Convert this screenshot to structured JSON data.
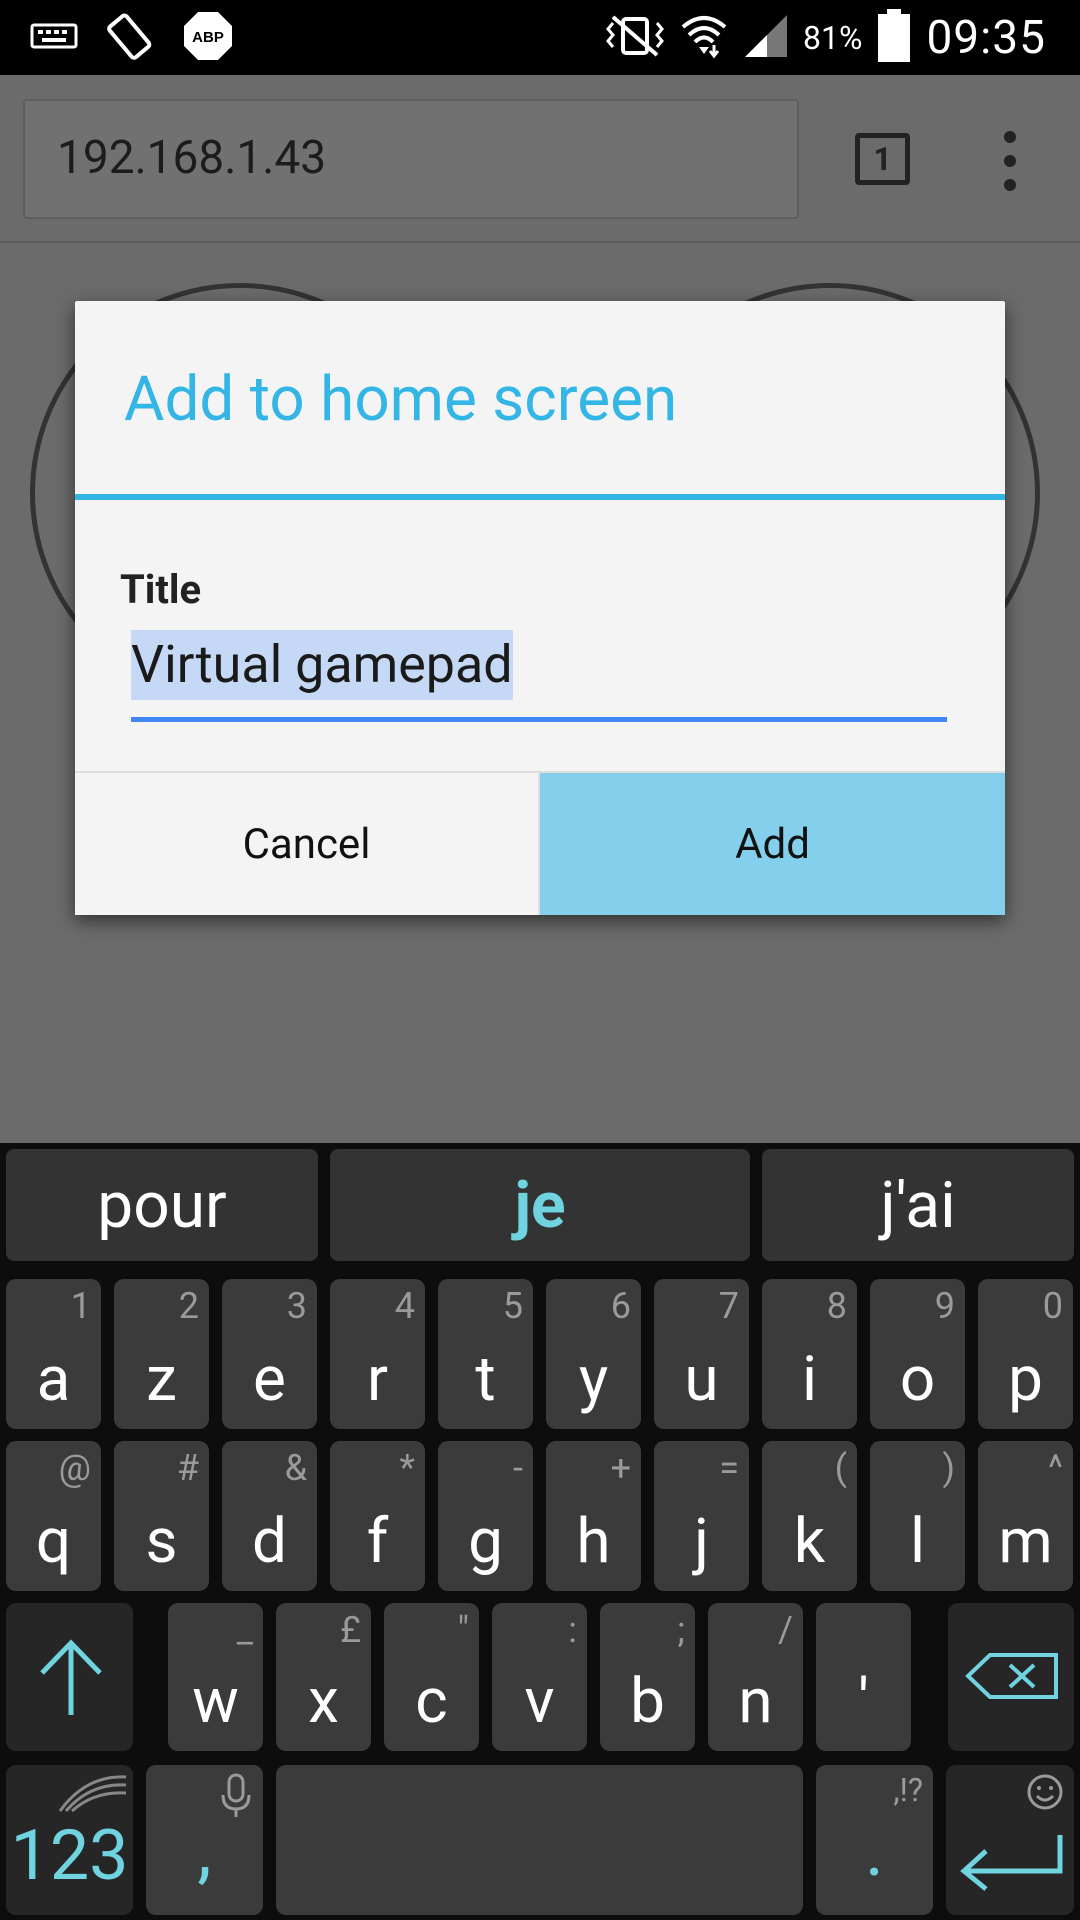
{
  "status_bar": {
    "battery": "81%",
    "time": "09:35"
  },
  "browser": {
    "url": "192.168.1.43",
    "tab_count": "1"
  },
  "dialog": {
    "title": "Add to home screen",
    "field_label": "Title",
    "field_value": "Virtual gamepad",
    "cancel_label": "Cancel",
    "add_label": "Add"
  },
  "keyboard": {
    "suggestions": [
      "pour",
      "je",
      "j'ai"
    ],
    "row1": [
      {
        "key": "a",
        "hint": "1"
      },
      {
        "key": "z",
        "hint": "2"
      },
      {
        "key": "e",
        "hint": "3"
      },
      {
        "key": "r",
        "hint": "4"
      },
      {
        "key": "t",
        "hint": "5"
      },
      {
        "key": "y",
        "hint": "6"
      },
      {
        "key": "u",
        "hint": "7"
      },
      {
        "key": "i",
        "hint": "8"
      },
      {
        "key": "o",
        "hint": "9"
      },
      {
        "key": "p",
        "hint": "0"
      }
    ],
    "row2": [
      {
        "key": "q",
        "hint": "@"
      },
      {
        "key": "s",
        "hint": "#"
      },
      {
        "key": "d",
        "hint": "&"
      },
      {
        "key": "f",
        "hint": "*"
      },
      {
        "key": "g",
        "hint": "-"
      },
      {
        "key": "h",
        "hint": "+"
      },
      {
        "key": "j",
        "hint": "="
      },
      {
        "key": "k",
        "hint": "("
      },
      {
        "key": "l",
        "hint": ")"
      },
      {
        "key": "m",
        "hint": "^"
      }
    ],
    "row3": [
      {
        "key": "w",
        "hint": "_"
      },
      {
        "key": "x",
        "hint": "£"
      },
      {
        "key": "c",
        "hint": "\""
      },
      {
        "key": "v",
        "hint": ":"
      },
      {
        "key": "b",
        "hint": ";"
      },
      {
        "key": "n",
        "hint": "/"
      },
      {
        "key": "'",
        "hint": ""
      }
    ],
    "numbers_label": "123",
    "comma_label": ",",
    "period_label": ".",
    "period_hint": ",!?",
    "accent_color": "#6fd3e0"
  }
}
